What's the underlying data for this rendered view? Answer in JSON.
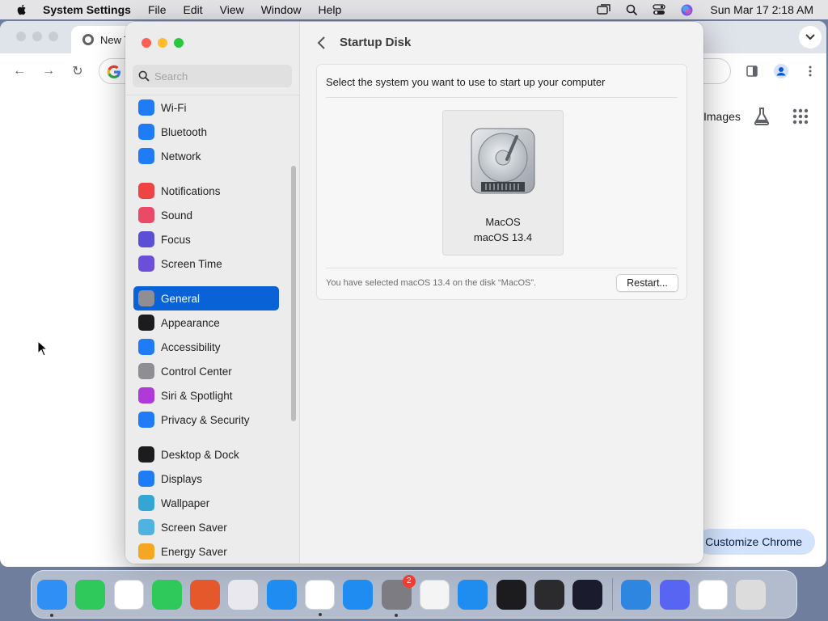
{
  "menubar": {
    "app_name": "System Settings",
    "menus": [
      "File",
      "Edit",
      "View",
      "Window",
      "Help"
    ],
    "clock": "Sun Mar 17  2:18 AM"
  },
  "chrome": {
    "tab_title": "New T",
    "images_link": "Images",
    "customize_button": "Customize Chrome"
  },
  "settings": {
    "search_placeholder": "Search",
    "sidebar_items": [
      {
        "label": "Wi-Fi",
        "icon": "wifi-icon",
        "color": "#1f7cf6"
      },
      {
        "label": "Bluetooth",
        "icon": "bluetooth-icon",
        "color": "#1f7cf6"
      },
      {
        "label": "Network",
        "icon": "network-icon",
        "color": "#1f7cf6"
      },
      {
        "label": "Notifications",
        "icon": "notifications-icon",
        "color": "#ef4444"
      },
      {
        "label": "Sound",
        "icon": "sound-icon",
        "color": "#ea4a66"
      },
      {
        "label": "Focus",
        "icon": "focus-icon",
        "color": "#5b4fd6"
      },
      {
        "label": "Screen Time",
        "icon": "screen-time-icon",
        "color": "#6b4fd8"
      },
      {
        "label": "General",
        "icon": "general-icon",
        "color": "#8e8e93",
        "selected": true
      },
      {
        "label": "Appearance",
        "icon": "appearance-icon",
        "color": "#1c1c1e"
      },
      {
        "label": "Accessibility",
        "icon": "accessibility-icon",
        "color": "#1f7cf6"
      },
      {
        "label": "Control Center",
        "icon": "control-center-icon",
        "color": "#8e8e93"
      },
      {
        "label": "Siri & Spotlight",
        "icon": "siri-icon",
        "color": "#b03ad8"
      },
      {
        "label": "Privacy & Security",
        "icon": "privacy-hand-icon",
        "color": "#1f7cf6"
      },
      {
        "label": "Desktop & Dock",
        "icon": "desktop-dock-icon",
        "color": "#1c1c1e"
      },
      {
        "label": "Displays",
        "icon": "displays-icon",
        "color": "#1f7cf6"
      },
      {
        "label": "Wallpaper",
        "icon": "wallpaper-icon",
        "color": "#34a6d6"
      },
      {
        "label": "Screen Saver",
        "icon": "screen-saver-icon",
        "color": "#4fb2e0"
      },
      {
        "label": "Energy Saver",
        "icon": "energy-saver-icon",
        "color": "#f5a623"
      }
    ],
    "page_title": "Startup Disk",
    "prompt": "Select the system you want to use to start up your computer",
    "disk": {
      "name": "MacOS",
      "version": "macOS 13.4"
    },
    "status_text": "You have selected macOS 13.4 on the disk “MacOS”.",
    "restart_label": "Restart..."
  },
  "dock": {
    "apps": [
      {
        "name": "Finder",
        "icon": "finder-icon",
        "color": "#2f8ff5",
        "running": true
      },
      {
        "name": "FaceTime",
        "icon": "facetime-icon",
        "color": "#2fc85a"
      },
      {
        "name": "Visual Studio Code",
        "icon": "vscode-icon",
        "color": "#ffffff"
      },
      {
        "name": "Messages",
        "icon": "messages-icon",
        "color": "#2fc85a"
      },
      {
        "name": "Firefox",
        "icon": "firefox-icon",
        "color": "#e5582c"
      },
      {
        "name": "Launchpad",
        "icon": "launchpad-icon",
        "color": "#e8e8ee"
      },
      {
        "name": "Safari",
        "icon": "safari-icon",
        "color": "#1e8cf0"
      },
      {
        "name": "Google Chrome",
        "icon": "chrome-icon",
        "color": "#ffffff",
        "running": true
      },
      {
        "name": "App Store",
        "icon": "app-store-icon",
        "color": "#1e8cf0"
      },
      {
        "name": "System Settings",
        "icon": "system-settings-icon",
        "color": "#7c7c82",
        "running": true,
        "badge": "2"
      },
      {
        "name": "TextEdit",
        "icon": "textedit-icon",
        "color": "#f4f4f4"
      },
      {
        "name": "Keynote",
        "icon": "keynote-icon",
        "color": "#1f8cf0"
      },
      {
        "name": "Terminal",
        "icon": "terminal-icon",
        "color": "#1c1c1e"
      },
      {
        "name": "GarageBand",
        "icon": "garageband-icon",
        "color": "#2b2b2e"
      },
      {
        "name": "Siri",
        "icon": "siri-dock-icon",
        "color": "#1b1b2e"
      },
      {
        "name": "Weather",
        "icon": "weather-icon",
        "color": "#2e86e0"
      },
      {
        "name": "Discord",
        "icon": "discord-icon",
        "color": "#5865f2"
      },
      {
        "name": "CapCut",
        "icon": "capcut-icon",
        "color": "#ffffff"
      },
      {
        "name": "Trash",
        "icon": "trash-icon",
        "color": "#dcdcdc"
      }
    ]
  }
}
